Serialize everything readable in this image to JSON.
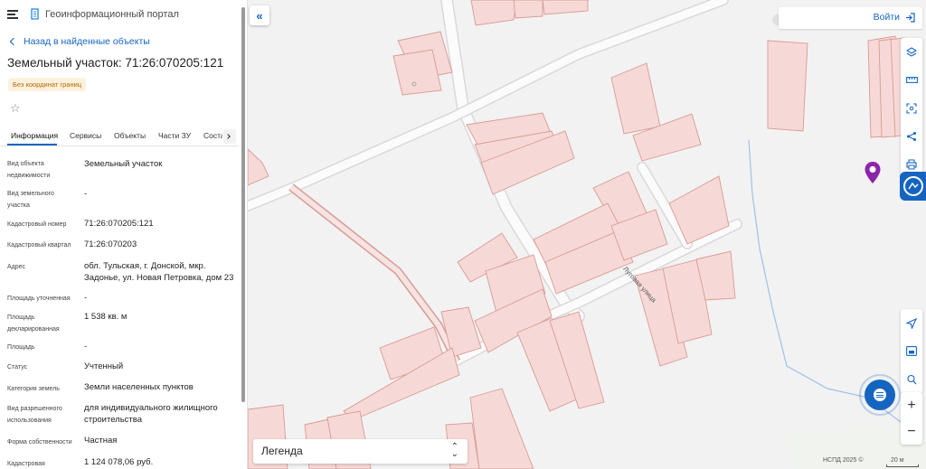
{
  "header": {
    "portal_title": "Геоинформационный портал"
  },
  "sidebar": {
    "back_link": "Назад в найденные объекты",
    "object_title": "Земельный участок: 71:26:070205:121",
    "badge": "Без координат границ",
    "tabs": [
      {
        "label": "Информация",
        "active": true
      },
      {
        "label": "Сервисы",
        "active": false
      },
      {
        "label": "Объекты",
        "active": false
      },
      {
        "label": "Части ЗУ",
        "active": false
      },
      {
        "label": "Соста",
        "active": false
      }
    ],
    "fields": [
      {
        "label": "Вид объекта недвижимости",
        "value": "Земельный участок"
      },
      {
        "label": "Вид земельного участка",
        "value": "-"
      },
      {
        "label": "Кадастровый номер",
        "value": "71:26:070205:121"
      },
      {
        "label": "Кадастровый квартал",
        "value": "71:26:070203"
      },
      {
        "label": "Адрес",
        "value": "обл. Тульская, г. Донской, мкр. Задонье, ул. Новая Петровка, дом 23"
      },
      {
        "label": "Площадь уточненная",
        "value": "-"
      },
      {
        "label": "Площадь декларированная",
        "value": "1 538 кв. м"
      },
      {
        "label": "Площадь",
        "value": "-"
      },
      {
        "label": "Статус",
        "value": "Учтенный"
      },
      {
        "label": "Категория земель",
        "value": "Земли населенных пунктов"
      },
      {
        "label": "Вид разрешенного использования",
        "value": "для индивидуального жилищного строительства"
      },
      {
        "label": "Форма собственности",
        "value": "Частная"
      },
      {
        "label": "Кадастровая",
        "value": "1 124 078,06 руб."
      }
    ]
  },
  "map": {
    "login_label": "Войти",
    "legend_label": "Легенда",
    "street_label": "Луговая улица",
    "attribution": "НСПД 2025 ©",
    "scale_label": "20 м",
    "colors": {
      "parcel_fill": "#f6d9d6",
      "parcel_stroke": "#d99a94",
      "accent": "#1565c0",
      "marker": "#8e24aa",
      "water": "#9ec2e6"
    },
    "tools": [
      "layers-icon",
      "ruler-icon",
      "select-area-icon",
      "share-icon",
      "print-icon",
      "nspd-icon",
      "locate-icon",
      "basemap-icon",
      "geo-search-icon"
    ]
  }
}
